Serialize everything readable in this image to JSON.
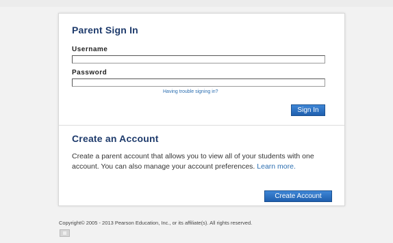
{
  "signin": {
    "title": "Parent Sign In",
    "username_label": "Username",
    "username_value": "",
    "password_label": "Password",
    "password_value": "",
    "trouble_link": "Having trouble signing in?",
    "signin_button": "Sign In"
  },
  "create_account": {
    "title": "Create an Account",
    "description": "Create a parent account that allows you to view all of your students with one account. You can also manage your account preferences. ",
    "learn_more": "Learn more.",
    "create_button": "Create Account"
  },
  "footer": {
    "copyright": "Copyright© 2005 - 2013 Pearson Education, Inc., or its affiliate(s). All rights reserved."
  },
  "colors": {
    "title": "#1d3a6b",
    "link": "#2a6db0",
    "button": "#2b6cc0",
    "background": "#f2f2f2"
  }
}
